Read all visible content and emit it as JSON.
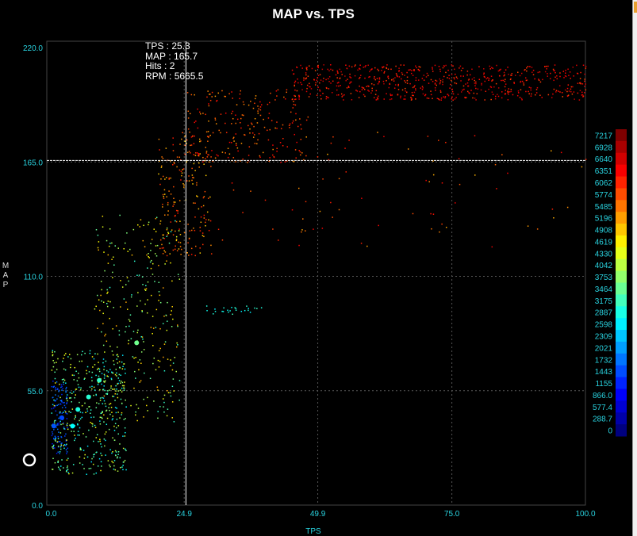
{
  "chart_data": {
    "type": "scatter",
    "title": "MAP vs. TPS",
    "xlabel": "TPS",
    "ylabel": "MAP",
    "xlim": [
      0,
      100
    ],
    "ylim": [
      0,
      220
    ],
    "x_ticks": [
      "0.0",
      "24.9",
      "49.9",
      "75.0",
      "100.0"
    ],
    "x_tick_values": [
      0,
      24.9,
      49.9,
      75.0,
      100.0
    ],
    "y_ticks": [
      "0.0",
      "55.0",
      "110.0",
      "165.0",
      "220.0"
    ],
    "y_tick_values": [
      0,
      55,
      110,
      165,
      220
    ],
    "grid": true,
    "color_by": "RPM",
    "colorbar": {
      "placement": "right",
      "labels": [
        "7217",
        "6928",
        "6640",
        "6351",
        "6062",
        "5774",
        "5485",
        "5196",
        "4908",
        "4619",
        "4330",
        "4042",
        "3753",
        "3464",
        "3175",
        "2887",
        "2598",
        "2309",
        "2021",
        "1732",
        "1443",
        "1155",
        "866.0",
        "577.4",
        "288.7",
        "0"
      ],
      "min": 0,
      "max": 7217
    },
    "cursor": {
      "tps": 25.3,
      "map": 165.7
    },
    "readout": [
      {
        "key": "TPS",
        "value": "25.3"
      },
      {
        "key": "MAP",
        "value": "165.7"
      },
      {
        "key": "Hits",
        "value": "2"
      },
      {
        "key": "RPM",
        "value": "5665.5"
      }
    ],
    "clusters": [
      {
        "x": [
          0,
          3
        ],
        "y": [
          25,
          60
        ],
        "rpm": [
          1000,
          1800
        ],
        "n": 120
      },
      {
        "x": [
          0,
          14
        ],
        "y": [
          15,
          75
        ],
        "rpm": [
          2400,
          4600
        ],
        "n": 420
      },
      {
        "x": [
          8,
          24
        ],
        "y": [
          40,
          140
        ],
        "rpm": [
          3000,
          5200
        ],
        "n": 300
      },
      {
        "x": [
          20,
          30
        ],
        "y": [
          120,
          180
        ],
        "rpm": [
          4800,
          6200
        ],
        "n": 200
      },
      {
        "x": [
          25,
          48
        ],
        "y": [
          165,
          200
        ],
        "rpm": [
          5200,
          6400
        ],
        "n": 220
      },
      {
        "x": [
          45,
          100
        ],
        "y": [
          195,
          212
        ],
        "rpm": [
          5800,
          6800
        ],
        "n": 650
      },
      {
        "x": [
          30,
          100
        ],
        "y": [
          120,
          180
        ],
        "rpm": [
          5000,
          6500
        ],
        "n": 80
      },
      {
        "x": [
          29,
          40
        ],
        "y": [
          92,
          96
        ],
        "rpm": [
          2600,
          3200
        ],
        "n": 25
      }
    ],
    "marker_circle": {
      "tps": -4,
      "map": 20
    }
  }
}
